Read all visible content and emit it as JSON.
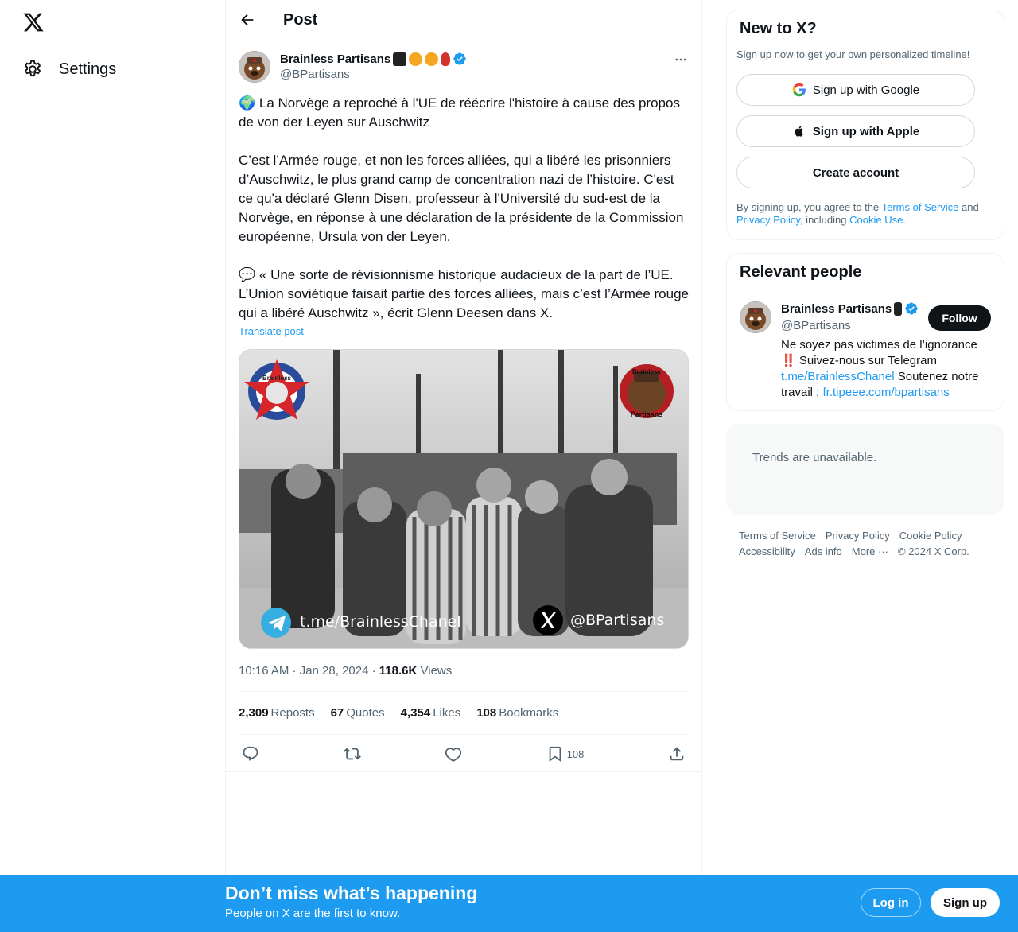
{
  "nav": {
    "logo_icon": "x-logo-icon",
    "settings_label": "Settings"
  },
  "topbar": {
    "title": "Post"
  },
  "post": {
    "author_name": "Brainless Partisans",
    "handle": "@BPartisans",
    "text": "🌍 La Norvège a reproché à l'UE de réécrire l'histoire à cause des propos de von der Leyen sur Auschwitz\n\nC’est l’Armée rouge, et non les forces alliées, qui a libéré les prisonniers d’Auschwitz, le plus grand camp de concentration nazi de l’histoire. C'est ce qu'a déclaré Glenn Disen, professeur à l'Université du sud-est de la Norvège, en réponse à une déclaration de la présidente de la Commission européenne, Ursula von der Leyen.\n\n💬 « Une sorte de révisionnisme historique audacieux de la part de l’UE. L’Union soviétique faisait partie des forces alliées, mais c’est l’Armée rouge qui a libéré Auschwitz », écrit Glenn Deesen dans X.",
    "translate_label": "Translate post",
    "media": {
      "watermark_left_logo": "Brainless",
      "watermark_right_logo": [
        "Brainless",
        "Partisans"
      ],
      "telegram_text": "t.me/BrainlessChanel",
      "x_handle_text": "@BPartisans"
    },
    "time": "10:16 AM · Jan 28, 2024",
    "views_count": "118.6K",
    "views_label": "Views",
    "stats": {
      "reposts_count": "2,309",
      "reposts_label": "Reposts",
      "quotes_count": "67",
      "quotes_label": "Quotes",
      "likes_count": "4,354",
      "likes_label": "Likes",
      "bookmarks_count": "108",
      "bookmarks_label": "Bookmarks"
    },
    "actions": {
      "bookmark_count": "108"
    }
  },
  "newx": {
    "title": "New to X?",
    "subtitle": "Sign up now to get your own personalized timeline!",
    "google_label": "Sign up with Google",
    "apple_label": "Sign up with Apple",
    "create_label": "Create account",
    "legal_prefix": "By signing up, you agree to the ",
    "terms_link": "Terms of Service",
    "and_text": " and ",
    "privacy_link": "Privacy Policy",
    "including_text": ", including ",
    "cookie_link": "Cookie Use."
  },
  "relevant": {
    "title": "Relevant people",
    "name": "Brainless Partisans",
    "handle": "@BPartisans",
    "follow_label": "Follow",
    "bio_line1": "Ne soyez pas victimes de l’ignorance",
    "bio_line2": "‼️ Suivez-nous sur Telegram",
    "bio_link1": "t.me/BrainlessChanel",
    "bio_mid": " Soutenez notre travail : ",
    "bio_link2": "fr.tipeee.com/bpartisans"
  },
  "trends": {
    "text": "Trends are unavailable."
  },
  "footer": {
    "terms": "Terms of Service",
    "privacy": "Privacy Policy",
    "cookie": "Cookie Policy",
    "accessibility": "Accessibility",
    "ads": "Ads info",
    "more": "More ···",
    "copyright": "© 2024 X Corp."
  },
  "bottombar": {
    "title": "Don’t miss what’s happening",
    "subtitle": "People on X are the first to know.",
    "login_label": "Log in",
    "signup_label": "Sign up"
  },
  "colors": {
    "accent": "#1d9bf0",
    "text": "#0f1419",
    "muted": "#536471"
  }
}
